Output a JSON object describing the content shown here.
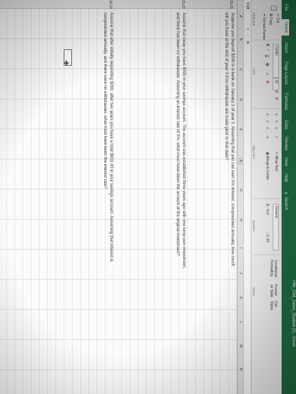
{
  "title_bar": {
    "file_name": "HW_Ch4_Jones_Student (2) - Excel"
  },
  "tabs": [
    "File",
    "Home",
    "Insert",
    "Page Layout",
    "Formulas",
    "Data",
    "Review",
    "View",
    "Help"
  ],
  "search_label": "Search",
  "ribbon": {
    "cut": "Cut",
    "copy": "Copy",
    "format_painter": "Format Painter",
    "clipboard_group": "Clipboard",
    "font_name": "Calibri",
    "font_size": "11",
    "bold": "B",
    "italic": "I",
    "underline": "U",
    "font_group": "Font",
    "wrap_text": "Wrap Text",
    "merge_center": "Merge & Center",
    "alignment_group": "Alignment",
    "number_format": "General",
    "currency": "$ - % 9",
    "number_group": "Number",
    "conditional_formatting": "Conditional Formatting",
    "format_as_table": "Format as Table",
    "cell_styles": "Cell Styles",
    "styles_group": "Styles"
  },
  "formula_bar": {
    "name_box": "F18",
    "cancel": "✕",
    "enter": "✓",
    "fx": "fx",
    "value": ""
  },
  "columns": [
    "A",
    "B",
    "C",
    "D",
    "E",
    "F",
    "G",
    "H",
    "I",
    "J",
    "K",
    "L",
    "M",
    "N"
  ],
  "rows": [
    {
      "label": "15-21",
      "line1": "Suppose you deposit $200 in a bank on January 1 of year 1. Assuming that you can earn 6% interest, compounded annually, how much",
      "line2": "will you have at the end of year 3 if no withdrawals are made prior to that date?"
    },
    {
      "label": "15-22",
      "line1": "Assume that today you have $500 in your savings account. The account was established three years ago with one lump-sum investment,",
      "line2": "and there has been no withdrawals. Assuming an interest rate of 5%, what must have been the amount of the original investment?"
    },
    {
      "label": "16-23",
      "line1": "Assume that after initially depositing $280, after two years you have a total $601.43 in your savings account. Assuming that interest is",
      "line2": "compounded annually, and there were no withdrawals, what must have been the interest rate?"
    }
  ]
}
